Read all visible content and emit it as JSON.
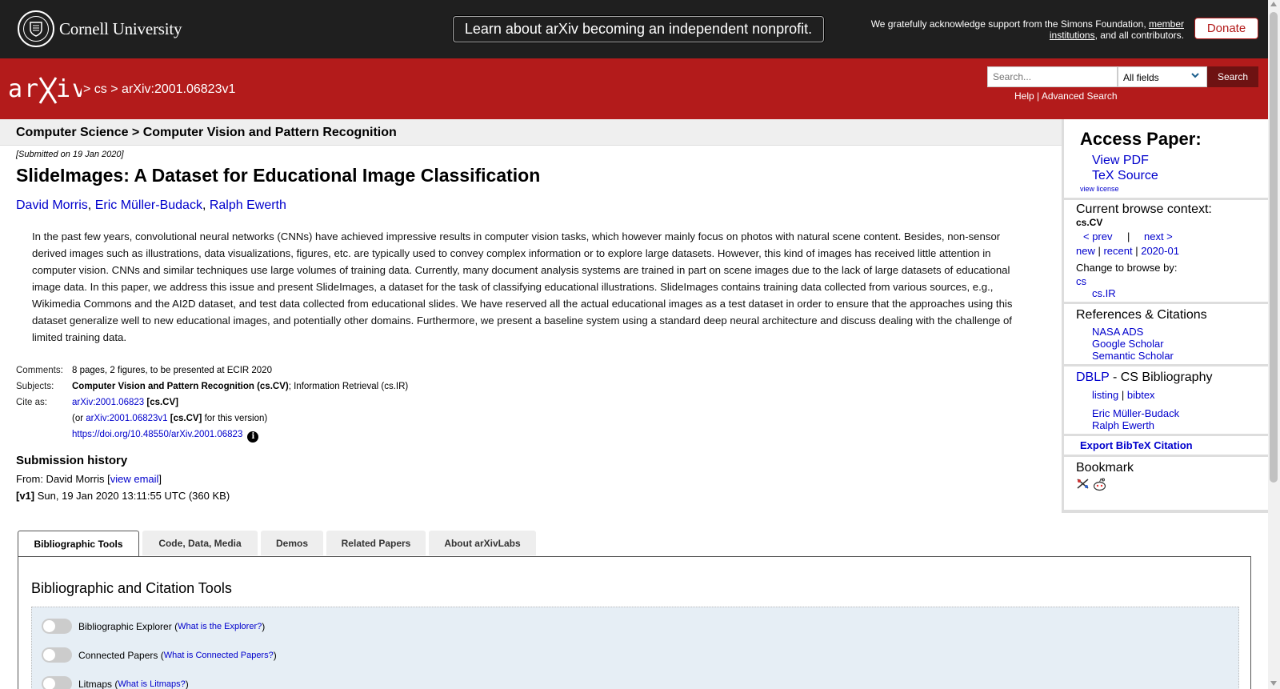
{
  "topbar": {
    "university": "Cornell University",
    "announcement": "Learn about arXiv becoming an independent nonprofit.",
    "support_pre": "We gratefully acknowledge support from the Simons Foundation, ",
    "support_link1": "member",
    "support_link2": "institutions",
    "support_post": ", and all contributors.",
    "donate": "Donate"
  },
  "redbar": {
    "logo": "arXiv",
    "crumb_sep1": ">",
    "crumb_cs": "cs",
    "crumb_sep2": ">",
    "crumb_id": "arXiv:2001.06823v1",
    "search_placeholder": "Search...",
    "search_field": "All fields",
    "search_button": "Search",
    "help": "Help",
    "pipe": " | ",
    "advanced": "Advanced Search"
  },
  "subheader": "Computer Science > Computer Vision and Pattern Recognition",
  "paper": {
    "submitted": "[Submitted on 19 Jan 2020]",
    "title": "SlideImages: A Dataset for Educational Image Classification",
    "authors": [
      "David Morris",
      "Eric Müller-Budack",
      "Ralph Ewerth"
    ],
    "abstract": "In the past few years, convolutional neural networks (CNNs) have achieved impressive results in computer vision tasks, which however mainly focus on photos with natural scene content. Besides, non-sensor derived images such as illustrations, data visualizations, figures, etc. are typically used to convey complex information or to explore large datasets. However, this kind of images has received little attention in computer vision. CNNs and similar techniques use large volumes of training data. Currently, many document analysis systems are trained in part on scene images due to the lack of large datasets of educational image data. In this paper, we address this issue and present SlideImages, a dataset for the task of classifying educational illustrations. SlideImages contains training data collected from various sources, e.g., Wikimedia Commons and the AI2D dataset, and test data collected from educational slides. We have reserved all the actual educational images as a test dataset in order to ensure that the approaches using this dataset generalize well to new educational images, and potentially other domains. Furthermore, we present a baseline system using a standard deep neural architecture and discuss dealing with the challenge of limited training data.",
    "comments_label": "Comments:",
    "comments": "8 pages, 2 figures, to be presented at ECIR 2020",
    "subjects_label": "Subjects:",
    "subjects_primary": "Computer Vision and Pattern Recognition (cs.CV)",
    "subjects_rest": "; Information Retrieval (cs.IR)",
    "cite_label": "Cite as:",
    "cite_id": "arXiv:2001.06823",
    "cite_cat": "[cs.CV]",
    "cite2_pre": "(or ",
    "cite2_id": "arXiv:2001.06823v1",
    "cite2_cat": "[cs.CV]",
    "cite2_post": " for this version)",
    "doi": "https://doi.org/10.48550/arXiv.2001.06823",
    "history_heading": "Submission history",
    "from_pre": "From: David Morris [",
    "view_email": "view email",
    "from_post": "]",
    "v1_label": "[v1]",
    "v1_text": " Sun, 19 Jan 2020 13:11:55 UTC (360 KB)"
  },
  "sidebar": {
    "access": "Access Paper:",
    "view_pdf": "View PDF",
    "tex_source": "TeX Source",
    "view_license": "view license",
    "browse_context": "Current browse context:",
    "context": "cs.CV",
    "prev": "< prev",
    "pipe": "|",
    "next": "next >",
    "new": "new",
    "recent": "recent",
    "month": "2020-01",
    "change_browse": "Change to browse by:",
    "cs": "cs",
    "csir": "cs.IR",
    "refs": "References & Citations",
    "nasa": "NASA ADS",
    "google": "Google Scholar",
    "semantic": "Semantic Scholar",
    "dblp": "DBLP",
    "dblp_rest": " - CS Bibliography",
    "listing": "listing",
    "bibtex": "bibtex",
    "author1": "Eric Müller-Budack",
    "author2": "Ralph Ewerth",
    "export": "Export BibTeX Citation",
    "bookmark": "Bookmark"
  },
  "tabs": [
    "Bibliographic Tools",
    "Code, Data, Media",
    "Demos",
    "Related Papers",
    "About arXivLabs"
  ],
  "panel": {
    "heading": "Bibliographic and Citation Tools",
    "tools": [
      {
        "name": "Bibliographic Explorer",
        "link": "What is the Explorer?"
      },
      {
        "name": "Connected Papers",
        "link": "What is Connected Papers?"
      },
      {
        "name": "Litmaps",
        "link": "What is Litmaps?"
      }
    ]
  }
}
